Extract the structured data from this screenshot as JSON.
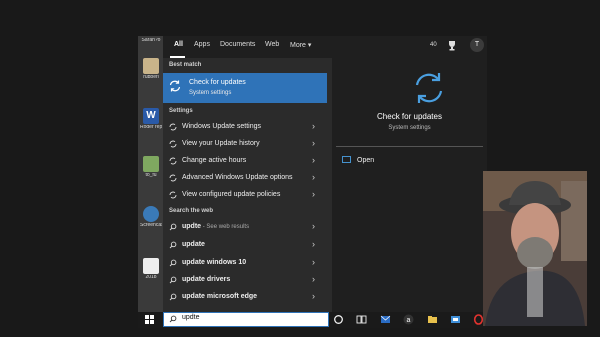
{
  "tabs": [
    "All",
    "Apps",
    "Documents",
    "Web",
    "More ▾"
  ],
  "header": {
    "points": "40",
    "avatar_initial": "T"
  },
  "sections": {
    "best_match": "Best match",
    "settings": "Settings",
    "search_web": "Search the web"
  },
  "best_match": {
    "title": "Check for updates",
    "subtitle": "System settings"
  },
  "settings_items": [
    "Windows Update settings",
    "View your Update history",
    "Change active hours",
    "Advanced Windows Update options",
    "View configured update policies"
  ],
  "web_items": [
    {
      "bold": "updte",
      "suffix": " - See web results"
    },
    {
      "bold": "update",
      "suffix": ""
    },
    {
      "bold": "update windows 10",
      "suffix": ""
    },
    {
      "bold": "update drivers",
      "suffix": ""
    },
    {
      "bold": "update microsoft edge",
      "suffix": ""
    }
  ],
  "preview": {
    "title": "Check for updates",
    "subtitle": "System settings",
    "open_label": "Open"
  },
  "search": {
    "query": "updte"
  },
  "desktop_icons": [
    {
      "label": "Sarah?o",
      "color": "#888888"
    },
    {
      "label": "rubberi",
      "color": "#c9b48a"
    },
    {
      "label": "Roder repeller",
      "color": "#2a5aa8"
    },
    {
      "label": "to_fu",
      "color": "#7fa860"
    },
    {
      "label": "Screencast",
      "color": "#3a7ab8"
    },
    {
      "label": "2018",
      "color": "#eeeeee"
    }
  ],
  "colors": {
    "accent": "#2f73b8",
    "panel": "#2b2b2b",
    "preview": "#1f1f1f"
  }
}
